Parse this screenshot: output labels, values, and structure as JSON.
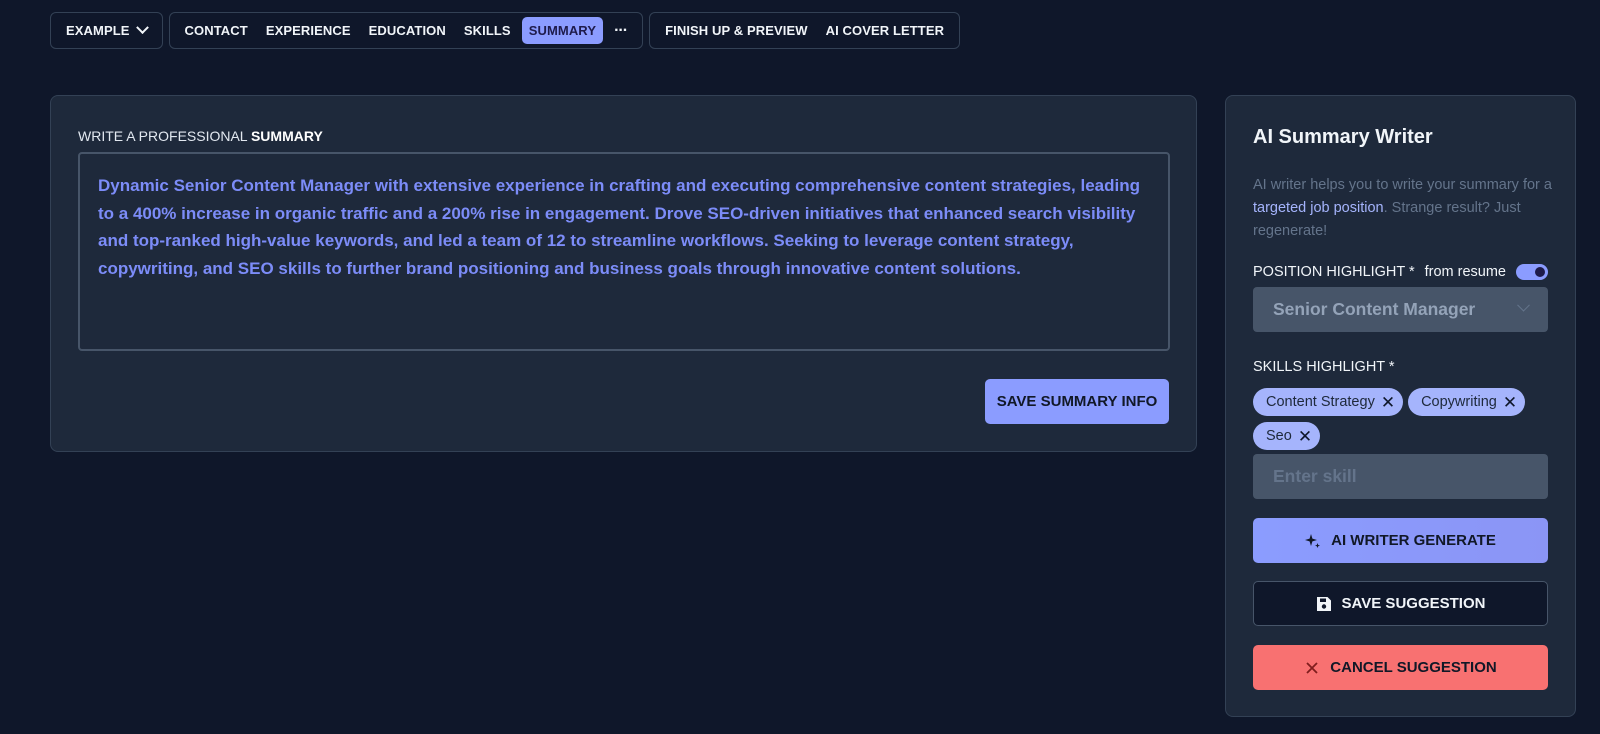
{
  "nav": {
    "example_label": "EXAMPLE",
    "sections": [
      "CONTACT",
      "EXPERIENCE",
      "EDUCATION",
      "SKILLS",
      "SUMMARY"
    ],
    "active_section": "SUMMARY",
    "more_label": "···",
    "finish_label": "FINISH UP & PREVIEW",
    "cover_label": "AI COVER LETTER"
  },
  "summary": {
    "label_prefix": "WRITE A PROFESSIONAL ",
    "label_bold": "SUMMARY",
    "text": "Dynamic Senior Content Manager with extensive experience in crafting and executing comprehensive content strategies, leading to a 400% increase in organic traffic and a 200% rise in engagement. Drove SEO-driven initiatives that enhanced search visibility and top-ranked high-value keywords, and led a team of 12 to streamline workflows. Seeking to leverage content strategy, copywriting, and SEO skills to further brand positioning and business goals through innovative content solutions.",
    "save_label": "SAVE SUMMARY INFO"
  },
  "ai_panel": {
    "title": "AI Summary Writer",
    "desc_before": "AI writer helps you to write your summary for a ",
    "desc_link": "targeted job position",
    "desc_after": ". Strange result? Just regenerate!",
    "position_label": "POSITION HIGHLIGHT *",
    "from_resume_label": "from resume",
    "from_resume_on": true,
    "position_value": "Senior Content Manager",
    "skills_label": "SKILLS HIGHLIGHT *",
    "skills": [
      "Content Strategy",
      "Copywriting",
      "Seo"
    ],
    "skill_placeholder": "Enter skill",
    "generate_label": "AI WRITER GENERATE",
    "save_suggestion_label": "SAVE SUGGESTION",
    "cancel_suggestion_label": "CANCEL SUGGESTION"
  },
  "colors": {
    "background": "#0f172a",
    "card": "#1e293b",
    "accent": "#8b9cff",
    "summary_text": "#7c8cf8",
    "danger": "#f87171"
  }
}
